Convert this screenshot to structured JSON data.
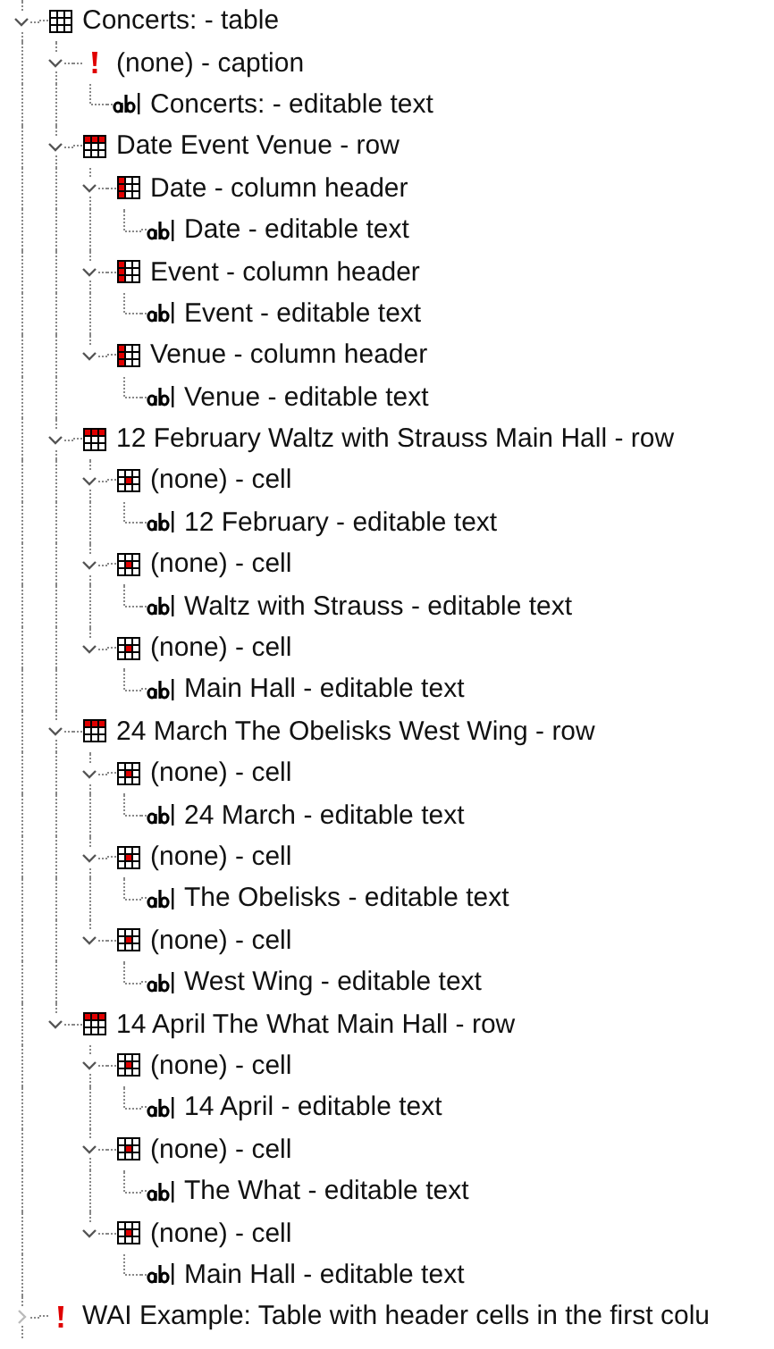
{
  "tree": [
    {
      "label": "Concerts: - table",
      "kind": "table",
      "expanded": true,
      "children": [
        {
          "label": "(none) - caption",
          "kind": "caption",
          "expanded": true,
          "children": [
            {
              "label": "Concerts: - editable text",
              "kind": "text"
            }
          ]
        },
        {
          "label": "Date Event Venue - row",
          "kind": "row",
          "expanded": true,
          "children": [
            {
              "label": "Date - column header",
              "kind": "header",
              "expanded": true,
              "children": [
                {
                  "label": "Date - editable text",
                  "kind": "text"
                }
              ]
            },
            {
              "label": "Event - column header",
              "kind": "header",
              "expanded": true,
              "children": [
                {
                  "label": "Event - editable text",
                  "kind": "text"
                }
              ]
            },
            {
              "label": "Venue - column header",
              "kind": "header",
              "expanded": true,
              "children": [
                {
                  "label": "Venue - editable text",
                  "kind": "text"
                }
              ]
            }
          ]
        },
        {
          "label": "12 February Waltz with Strauss Main Hall - row",
          "kind": "row",
          "expanded": true,
          "children": [
            {
              "label": "(none) - cell",
              "kind": "cell",
              "expanded": true,
              "children": [
                {
                  "label": "12 February - editable text",
                  "kind": "text"
                }
              ]
            },
            {
              "label": "(none) - cell",
              "kind": "cell",
              "expanded": true,
              "children": [
                {
                  "label": "Waltz with Strauss - editable text",
                  "kind": "text"
                }
              ]
            },
            {
              "label": "(none) - cell",
              "kind": "cell",
              "expanded": true,
              "children": [
                {
                  "label": "Main Hall - editable text",
                  "kind": "text"
                }
              ]
            }
          ]
        },
        {
          "label": "24 March The Obelisks West Wing - row",
          "kind": "row",
          "expanded": true,
          "children": [
            {
              "label": "(none) - cell",
              "kind": "cell",
              "expanded": true,
              "children": [
                {
                  "label": "24 March - editable text",
                  "kind": "text"
                }
              ]
            },
            {
              "label": "(none) - cell",
              "kind": "cell",
              "expanded": true,
              "children": [
                {
                  "label": "The Obelisks - editable text",
                  "kind": "text"
                }
              ]
            },
            {
              "label": "(none) - cell",
              "kind": "cell",
              "expanded": true,
              "children": [
                {
                  "label": "West Wing - editable text",
                  "kind": "text"
                }
              ]
            }
          ]
        },
        {
          "label": "14 April The What Main Hall - row",
          "kind": "row",
          "expanded": true,
          "children": [
            {
              "label": "(none) - cell",
              "kind": "cell",
              "expanded": true,
              "children": [
                {
                  "label": "14 April - editable text",
                  "kind": "text"
                }
              ]
            },
            {
              "label": "(none) - cell",
              "kind": "cell",
              "expanded": true,
              "children": [
                {
                  "label": "The What - editable text",
                  "kind": "text"
                }
              ]
            },
            {
              "label": "(none) - cell",
              "kind": "cell",
              "expanded": true,
              "children": [
                {
                  "label": "Main Hall - editable text",
                  "kind": "text"
                }
              ]
            }
          ]
        }
      ]
    },
    {
      "label": "WAI Example: Table with header cells in the first colu",
      "kind": "caption",
      "expanded": false
    }
  ]
}
